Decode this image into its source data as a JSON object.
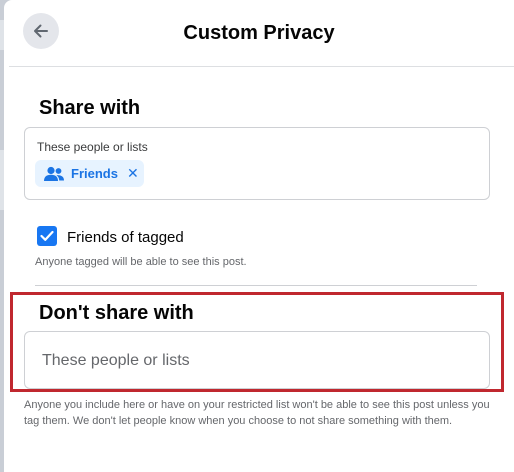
{
  "header": {
    "title": "Custom Privacy",
    "back_icon": "arrow-left-icon"
  },
  "share_with": {
    "title": "Share with",
    "field_label": "These people or lists",
    "chip": {
      "icon": "people-icon",
      "label": "Friends",
      "remove_glyph": "✕"
    }
  },
  "friends_of_tagged": {
    "checked": true,
    "label": "Friends of tagged",
    "help": "Anyone tagged will be able to see this post."
  },
  "dont_share_with": {
    "title": "Don't share with",
    "placeholder": "These people or lists",
    "footnote": "Anyone you include here or have on your restricted list won't be able to see this post unless you tag them. We don't let people know when you choose to not share something with them."
  },
  "colors": {
    "accent": "#1877f2",
    "chip_bg": "#e7f3ff",
    "highlight_border": "#c0282f"
  }
}
